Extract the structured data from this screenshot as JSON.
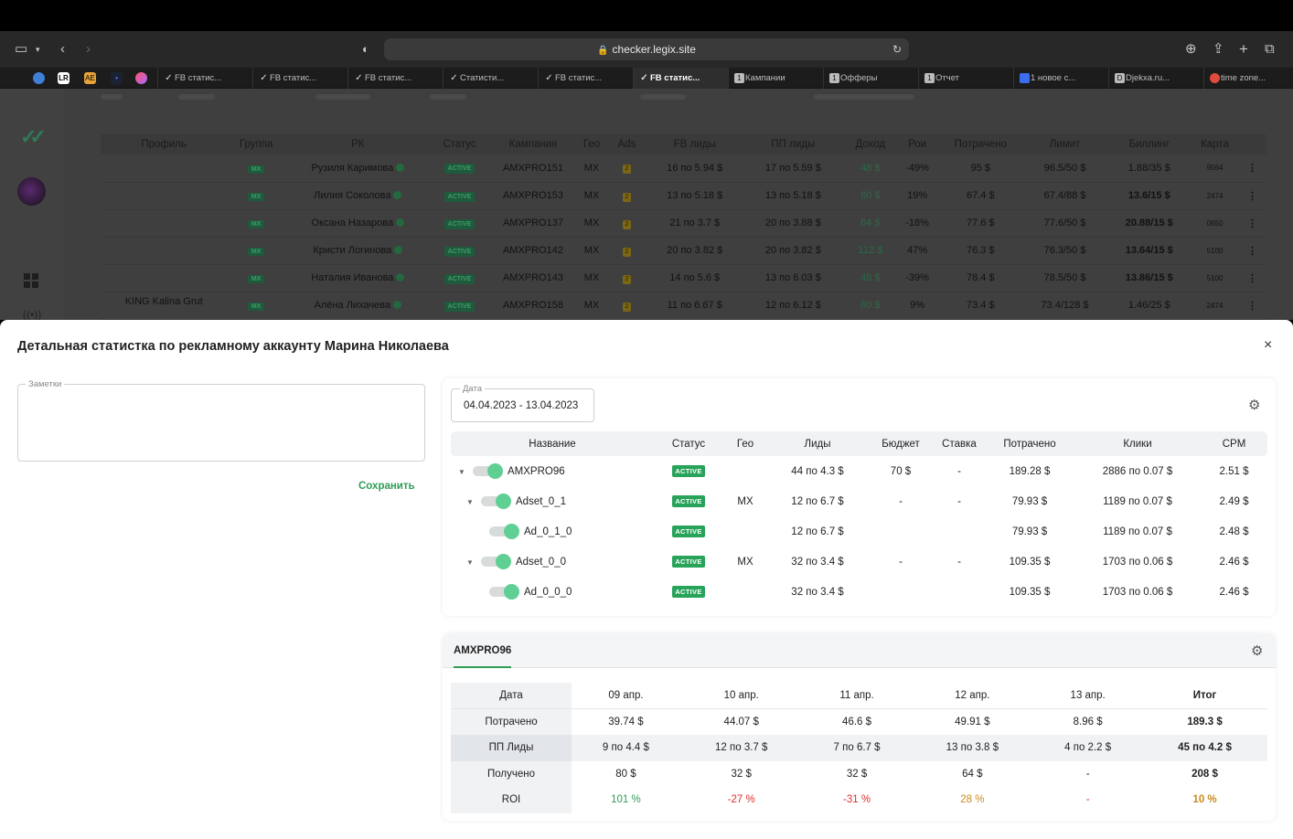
{
  "browser": {
    "url": "checker.legix.site",
    "tabs": [
      {
        "label": "FB статис...",
        "favicon": "check-icon",
        "selected": false
      },
      {
        "label": "FB статис...",
        "favicon": "check-icon",
        "selected": false
      },
      {
        "label": "FB статис...",
        "favicon": "check-icon",
        "selected": false
      },
      {
        "label": "Статисти...",
        "favicon": "check-icon",
        "selected": false
      },
      {
        "label": "FB статис...",
        "favicon": "check-icon",
        "selected": false
      },
      {
        "label": "FB статис...",
        "favicon": "check-icon",
        "selected": true
      },
      {
        "label": "Кампании",
        "favicon": "1",
        "selected": false
      },
      {
        "label": "Офферы",
        "favicon": "1",
        "selected": false
      },
      {
        "label": "Отчет",
        "favicon": "1",
        "selected": false
      },
      {
        "label": "1 новое с...",
        "favicon": "chat-icon",
        "selected": false
      },
      {
        "label": "Djekxa.ru...",
        "favicon": "D",
        "selected": false
      },
      {
        "label": "time zone...",
        "favicon": "google-icon",
        "selected": false
      }
    ],
    "pinned": [
      "LR",
      "AE"
    ]
  },
  "background_table": {
    "headers": [
      "Профиль",
      "Группа",
      "РК",
      "Статус",
      "Кампания",
      "Гео",
      "Ads",
      "FB лиды",
      "ПП лиды",
      "Доход",
      "Рои",
      "Потрачено",
      "Лимит",
      "Биллинг",
      "Карта"
    ],
    "profile": "KING Kalina Grut",
    "rows": [
      {
        "group": "MX",
        "rk": "Рузиля Каримова",
        "status": "ACTIVE",
        "campaign": "AMXPRO151",
        "geo": "MX",
        "ads": "2",
        "fb": "16 по 5.94 $",
        "pp": "17 по 5.59 $",
        "income": "48 $",
        "roi": "-49%",
        "spent": "95 $",
        "limit": "96.5/50 $",
        "billing": "1.88/35 $",
        "card": "9564"
      },
      {
        "group": "MX",
        "rk": "Лилия Соколова",
        "status": "ACTIVE",
        "campaign": "AMXPRO153",
        "geo": "MX",
        "ads": "2",
        "fb": "13 по 5.18 $",
        "pp": "13 по 5.18 $",
        "income": "80 $",
        "roi": "19%",
        "spent": "67.4 $",
        "limit": "67.4/88 $",
        "billing": "13.6/15 $",
        "card": "2474"
      },
      {
        "group": "MX",
        "rk": "Оксана Назарова",
        "status": "ACTIVE",
        "campaign": "AMXPRO137",
        "geo": "MX",
        "ads": "2",
        "fb": "21 по 3.7 $",
        "pp": "20 по 3.88 $",
        "income": "64 $",
        "roi": "-18%",
        "spent": "77.6 $",
        "limit": "77.6/50 $",
        "billing": "20.88/15 $",
        "card": "0650"
      },
      {
        "group": "MX",
        "rk": "Кристи Логинова",
        "status": "ACTIVE",
        "campaign": "AMXPRO142",
        "geo": "MX",
        "ads": "2",
        "fb": "20 по 3.82 $",
        "pp": "20 по 3.82 $",
        "income": "112 $",
        "roi": "47%",
        "spent": "76.3 $",
        "limit": "76.3/50 $",
        "billing": "13.64/15 $",
        "card": "5100"
      },
      {
        "group": "MX",
        "rk": "Наталия Иванова",
        "status": "ACTIVE",
        "campaign": "AMXPRO143",
        "geo": "MX",
        "ads": "2",
        "fb": "14 по 5.6 $",
        "pp": "13 по 6.03 $",
        "income": "48 $",
        "roi": "-39%",
        "spent": "78.4 $",
        "limit": "78.5/50 $",
        "billing": "13.86/15 $",
        "card": "5100"
      },
      {
        "group": "MX",
        "rk": "Алёна Лихачева",
        "status": "ACTIVE",
        "campaign": "AMXPRO158",
        "geo": "MX",
        "ads": "2",
        "fb": "11 по 6.67 $",
        "pp": "12 по 6.12 $",
        "income": "80 $",
        "roi": "9%",
        "spent": "73.4 $",
        "limit": "73.4/128 $",
        "billing": "1.46/25 $",
        "card": "2474"
      }
    ]
  },
  "modal": {
    "title": "Детальная статистка по рекламному аккаунту Марина Николаева",
    "close": "×",
    "notes_label": "Заметки",
    "notes_value": "",
    "save_label": "Сохранить",
    "date_label": "Дата",
    "date_value": "04.04.2023 - 13.04.2023",
    "tree_headers": [
      "Название",
      "Статус",
      "Гео",
      "Лиды",
      "Бюджет",
      "Ставка",
      "Потрачено",
      "Клики",
      "CPM"
    ],
    "tree_rows": [
      {
        "level": 0,
        "caret": true,
        "name": "AMXPRO96",
        "status": "ACTIVE",
        "geo": "",
        "leads": "44 по 4.3 $",
        "budget": "70 $",
        "bid": "-",
        "spent": "189.28 $",
        "clicks": "2886 по 0.07 $",
        "cpm": "2.51 $"
      },
      {
        "level": 1,
        "caret": true,
        "name": "Adset_0_1",
        "status": "ACTIVE",
        "geo": "MX",
        "leads": "12 по 6.7 $",
        "budget": "-",
        "bid": "-",
        "spent": "79.93 $",
        "clicks": "1189 по 0.07 $",
        "cpm": "2.49 $"
      },
      {
        "level": 2,
        "caret": false,
        "name": "Ad_0_1_0",
        "status": "ACTIVE",
        "geo": "",
        "leads": "12 по 6.7 $",
        "budget": "",
        "bid": "",
        "spent": "79.93 $",
        "clicks": "1189 по 0.07 $",
        "cpm": "2.48 $"
      },
      {
        "level": 1,
        "caret": true,
        "name": "Adset_0_0",
        "status": "ACTIVE",
        "geo": "MX",
        "leads": "32 по 3.4 $",
        "budget": "-",
        "bid": "-",
        "spent": "109.35 $",
        "clicks": "1703 по 0.06 $",
        "cpm": "2.46 $"
      },
      {
        "level": 2,
        "caret": false,
        "name": "Ad_0_0_0",
        "status": "ACTIVE",
        "geo": "",
        "leads": "32 по 3.4 $",
        "budget": "",
        "bid": "",
        "spent": "109.35 $",
        "clicks": "1703 по 0.06 $",
        "cpm": "2.46 $"
      }
    ],
    "daily_tab": "AMXPRO96",
    "daily": {
      "header_label": "Дата",
      "days": [
        "09 апр.",
        "10 апр.",
        "11 апр.",
        "12 апр.",
        "13 апр."
      ],
      "total_label": "Итог",
      "rows": [
        {
          "label": "Потрачено",
          "values": [
            "39.74 $",
            "44.07 $",
            "46.6 $",
            "49.91 $",
            "8.96 $"
          ],
          "total": "189.3 $"
        },
        {
          "label": "ПП Лиды",
          "values": [
            "9 по 4.4 $",
            "12 по 3.7 $",
            "7 по 6.7 $",
            "13 по 3.8 $",
            "4 по 2.2 $"
          ],
          "total": "45 по 4.2 $"
        },
        {
          "label": "Получено",
          "values": [
            "80 $",
            "32 $",
            "32 $",
            "64 $",
            "-"
          ],
          "total": "208 $"
        },
        {
          "label": "ROI",
          "values": [
            "101 %",
            "-27 %",
            "-31 %",
            "28 %",
            "-"
          ],
          "total": "10 %",
          "tones": [
            "pos",
            "neg",
            "neg",
            "mid",
            "neg"
          ],
          "total_tone": "mid"
        }
      ]
    }
  },
  "colors": {
    "accent": "#2f9d55",
    "active_badge": "#27a35a",
    "negative": "#d9302a",
    "warning": "#c98a1e",
    "toggle_knob": "#5fcf94"
  }
}
